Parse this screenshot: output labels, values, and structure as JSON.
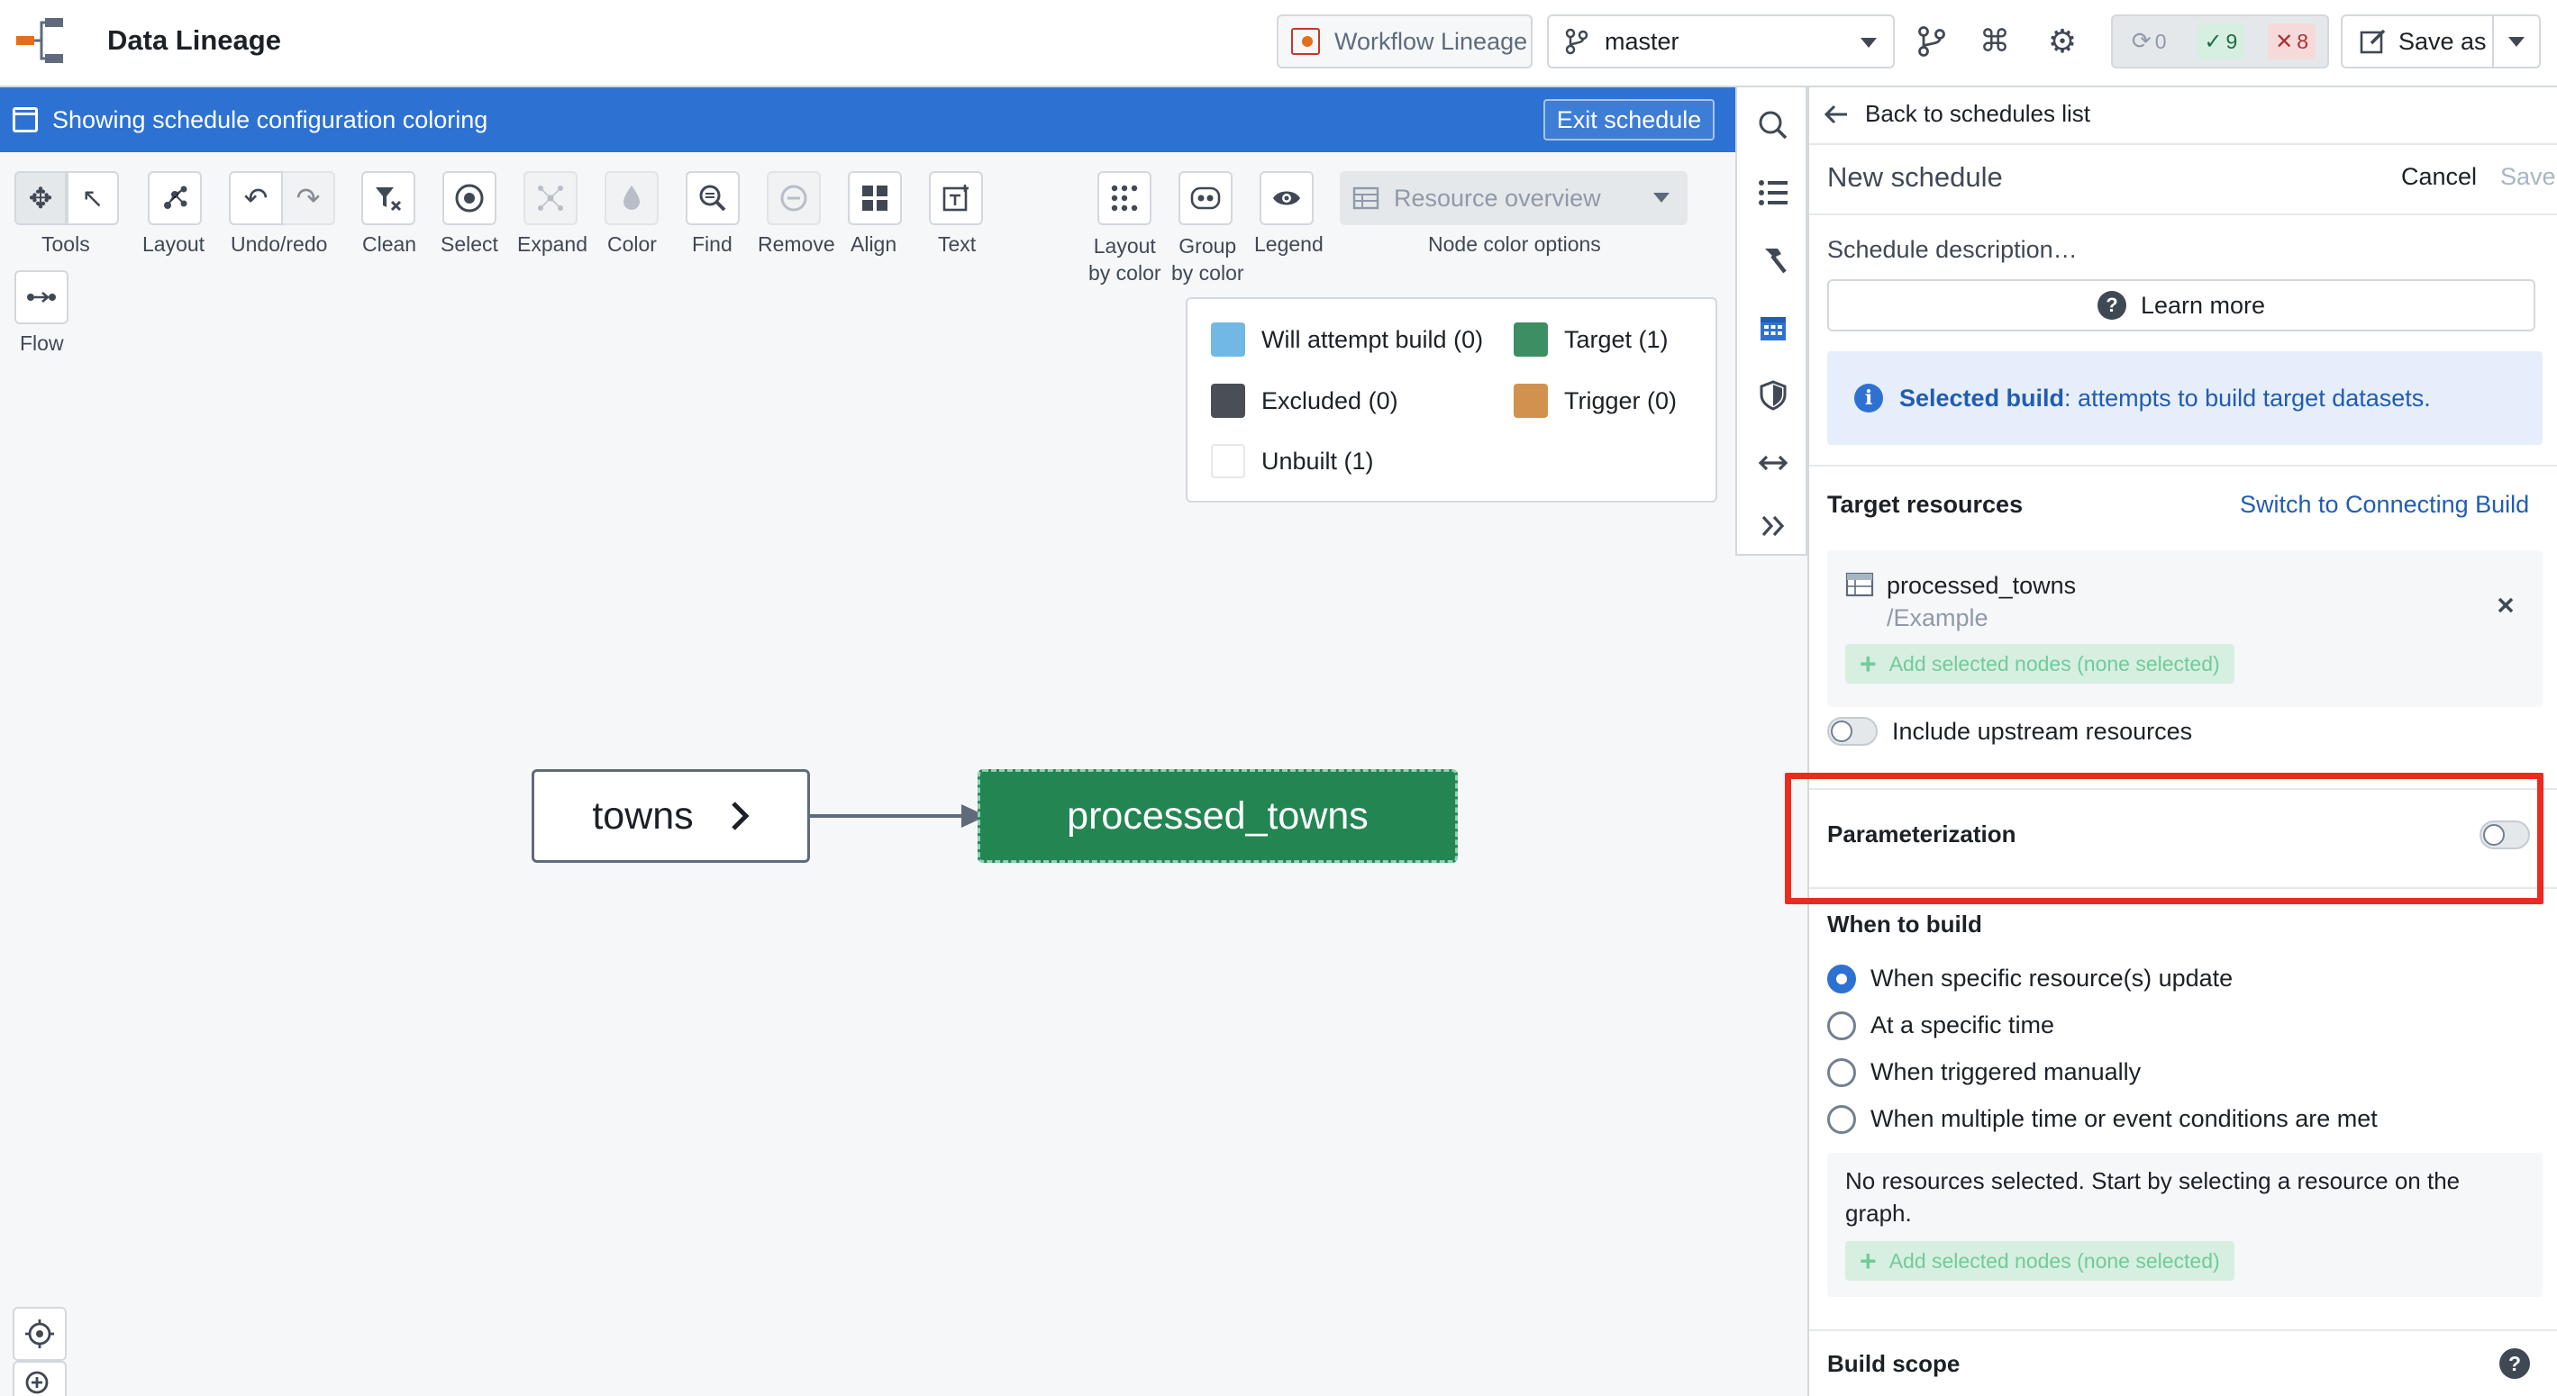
{
  "header": {
    "app_title": "Data Lineage",
    "workflow_lineage_label": "Workflow Lineage",
    "branch": "master",
    "status": {
      "pending": "0",
      "success": "9",
      "failed": "8"
    },
    "save_as_label": "Save as"
  },
  "schedule_bar": {
    "message": "Showing schedule configuration coloring",
    "exit_label": "Exit schedule"
  },
  "toolbar": {
    "tools_label": "Tools",
    "layout_label": "Layout",
    "undo_redo_label": "Undo/redo",
    "clean_label": "Clean",
    "select_label": "Select",
    "expand_label": "Expand",
    "color_label": "Color",
    "find_label": "Find",
    "remove_label": "Remove",
    "align_label": "Align",
    "text_label": "Text",
    "flow_label": "Flow",
    "layout_by_color_label_1": "Layout",
    "layout_by_color_label_2": "by color",
    "group_by_color_label_1": "Group",
    "group_by_color_label_2": "by color",
    "legend_label": "Legend",
    "node_color_select_value": "Resource overview",
    "node_color_options_label": "Node color options"
  },
  "legend": {
    "items": [
      {
        "label": "Will attempt build (0)",
        "color": "#72b8e5"
      },
      {
        "label": "Target (1)",
        "color": "#3d8f63"
      },
      {
        "label": "Excluded (0)",
        "color": "#4a4f56"
      },
      {
        "label": "Trigger (0)",
        "color": "#d1924f"
      },
      {
        "label": "Unbuilt (1)",
        "color": "#ffffff"
      }
    ]
  },
  "graph": {
    "source_node": "towns",
    "target_node": "processed_towns"
  },
  "panel": {
    "back_label": "Back to schedules list",
    "title": "New schedule",
    "cancel_label": "Cancel",
    "save_label": "Save",
    "description_placeholder": "Schedule description…",
    "learn_more_label": "Learn more",
    "callout_bold": "Selected build",
    "callout_text": ": attempts to build target datasets.",
    "target_resources_label": "Target resources",
    "switch_link": "Switch to Connecting Build",
    "resource_name": "processed_towns",
    "resource_path": "/Example",
    "add_nodes_label": "Add selected nodes (none selected)",
    "include_upstream_label": "Include upstream resources",
    "parameterization_label": "Parameterization",
    "when_to_build_label": "When to build",
    "radio_options": [
      "When specific resource(s) update",
      "At a specific time",
      "When triggered manually",
      "When multiple time or event conditions are met"
    ],
    "no_resources_text_1": "No resources selected. Start by selecting a resource on the",
    "no_resources_text_2": "graph.",
    "build_scope_label": "Build scope"
  }
}
